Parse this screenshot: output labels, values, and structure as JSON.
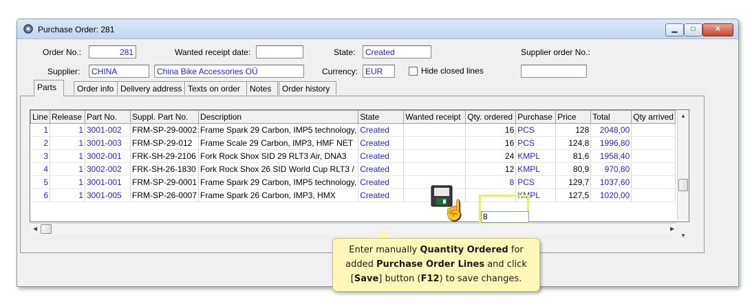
{
  "window": {
    "title": "Purchase Order: 281",
    "controls": [
      "minimize-icon",
      "maximize-icon",
      "close-icon"
    ]
  },
  "form": {
    "order_no_label": "Order No.:",
    "order_no_value": "281",
    "wanted_receipt_label": "Wanted receipt date:",
    "wanted_receipt_value": "",
    "state_label": "State:",
    "state_value": "Created",
    "supplier_order_label": "Supplier order No.:",
    "supplier_order_value": "",
    "supplier_label": "Supplier:",
    "supplier_code": "CHINA",
    "supplier_name": "China Bike Accessories OÜ",
    "currency_label": "Currency:",
    "currency_value": "EUR",
    "hide_closed_label": "Hide closed lines",
    "hide_closed_checked": false
  },
  "tabs": [
    "Parts",
    "Order info",
    "Delivery address",
    "Texts on order",
    "Notes",
    "Order history"
  ],
  "active_tab": "Parts",
  "table": {
    "columns": [
      "Line",
      "Release",
      "Part No.",
      "Suppl. Part No.",
      "Description",
      "State",
      "Wanted receipt",
      "Qty. ordered",
      "Purchase",
      "Price",
      "Total",
      "Qty arrived"
    ],
    "rows": [
      [
        "1",
        "1",
        "3001-002",
        "FRM-SP-29-0002",
        "Frame Spark 29 Carbon, IMP5 technology,",
        "Created",
        "",
        "16",
        "PCS",
        "128",
        "2048,00",
        ""
      ],
      [
        "2",
        "1",
        "3001-003",
        "FRM-SP-29-012",
        "Frame Scale 29 Carbon, IMP3, HMF NET",
        "Created",
        "",
        "16",
        "PCS",
        "124,8",
        "1996,80",
        ""
      ],
      [
        "3",
        "1",
        "3002-001",
        "FRK-SH-29-2106",
        "Fork Rock Shox SID 29 RLT3 Air, DNA3",
        "Created",
        "",
        "24",
        "KMPL",
        "81,6",
        "1958,40",
        ""
      ],
      [
        "4",
        "1",
        "3002-002",
        "FRK-SH-26-1830",
        "Fork Rock Shox 26 SID World Cup RLT3 /",
        "Created",
        "",
        "12",
        "KMPL",
        "80,9",
        "970,80",
        ""
      ],
      [
        "5",
        "1",
        "3001-001",
        "FRM-SP-29-0001",
        "Frame Spark 29 Carbon, IMP5 technology,",
        "Created",
        "",
        "8",
        "PCS",
        "129,7",
        "1037,60",
        ""
      ],
      [
        "6",
        "1",
        "3001-005",
        "FRM-SP-26-0007",
        "Frame Spark 26 Carbon, IMP3, HMX",
        "Created",
        "",
        "",
        "KMPL",
        "127,5",
        "1020,00",
        ""
      ]
    ],
    "editing_value": "8"
  },
  "callout": {
    "t1": "Enter manually ",
    "b1": "Quantity Ordered",
    "t2": " for added ",
    "b2": "Purchase Order Lines",
    "t3": " and click [",
    "b3": "Save",
    "t4": "] button (",
    "b4": "F12",
    "t5": ") to save changes."
  },
  "colors": {
    "value_text": "#2323d8",
    "highlight": "#e9f25b",
    "callout_bg": "#fff8b8"
  }
}
